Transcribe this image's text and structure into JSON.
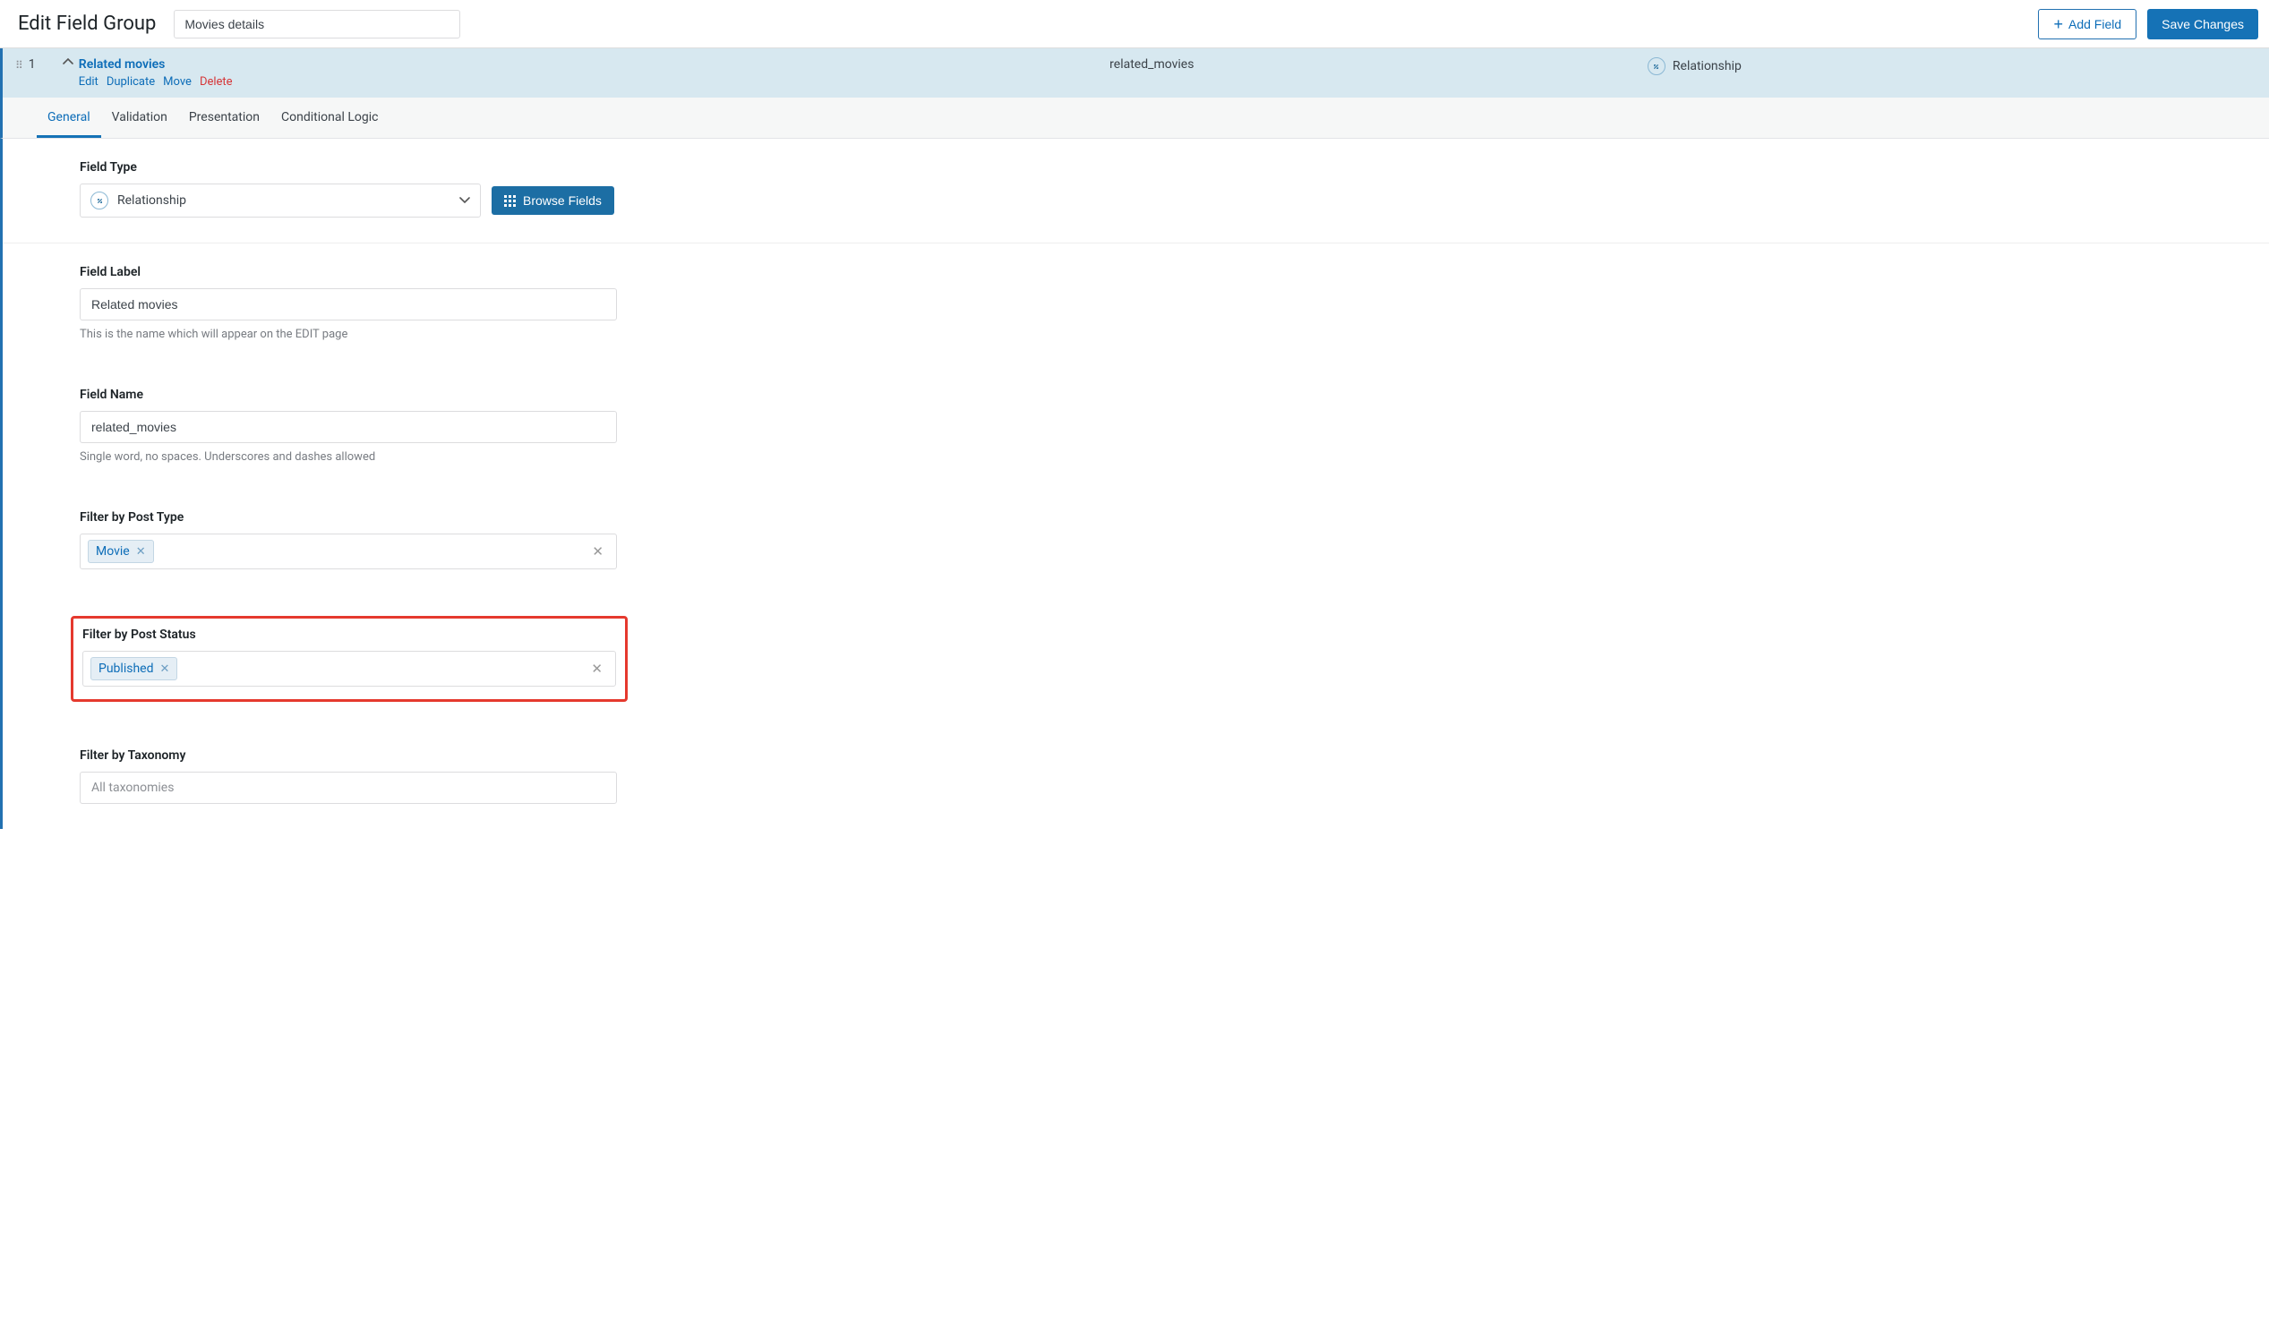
{
  "header": {
    "title": "Edit Field Group",
    "group_name": "Movies details",
    "add_field_label": "Add Field",
    "save_label": "Save Changes"
  },
  "field_row": {
    "index": "1",
    "title": "Related movies",
    "name": "related_movies",
    "type_label": "Relationship",
    "actions": {
      "edit": "Edit",
      "duplicate": "Duplicate",
      "move": "Move",
      "delete": "Delete"
    }
  },
  "tabs": {
    "general": "General",
    "validation": "Validation",
    "presentation": "Presentation",
    "conditional": "Conditional Logic"
  },
  "sections": {
    "field_type": {
      "label": "Field Type",
      "value": "Relationship",
      "browse_label": "Browse Fields"
    },
    "field_label": {
      "label": "Field Label",
      "value": "Related movies",
      "helper": "This is the name which will appear on the EDIT page"
    },
    "field_name": {
      "label": "Field Name",
      "value": "related_movies",
      "helper": "Single word, no spaces. Underscores and dashes allowed"
    },
    "filter_post_type": {
      "label": "Filter by Post Type",
      "tags": [
        "Movie"
      ]
    },
    "filter_post_status": {
      "label": "Filter by Post Status",
      "tags": [
        "Published"
      ]
    },
    "filter_taxonomy": {
      "label": "Filter by Taxonomy",
      "placeholder": "All taxonomies"
    }
  }
}
